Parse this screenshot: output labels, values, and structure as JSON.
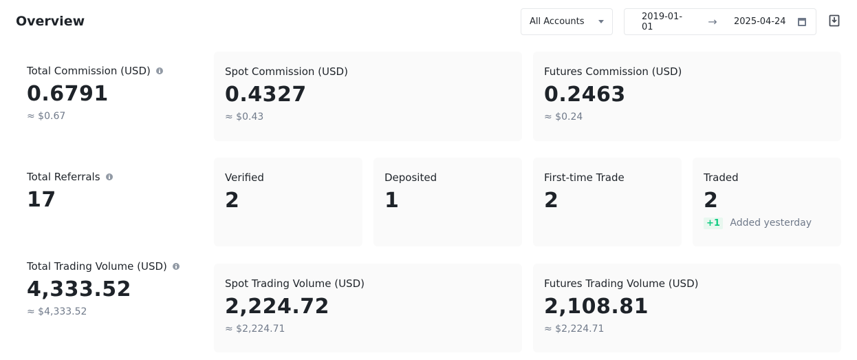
{
  "header": {
    "title": "Overview",
    "account_select": "All Accounts",
    "date_from": "2019-01-01",
    "date_to": "2025-04-24"
  },
  "commission": {
    "total": {
      "label": "Total Commission (USD)",
      "value": "0.6791",
      "approx": "≈ $0.67"
    },
    "spot": {
      "label": "Spot Commission (USD)",
      "value": "0.4327",
      "approx": "≈ $0.43"
    },
    "futures": {
      "label": "Futures Commission (USD)",
      "value": "0.2463",
      "approx": "≈ $0.24"
    }
  },
  "referrals": {
    "total": {
      "label": "Total Referrals",
      "value": "17"
    },
    "verified": {
      "label": "Verified",
      "value": "2"
    },
    "deposited": {
      "label": "Deposited",
      "value": "1"
    },
    "first_trade": {
      "label": "First-time Trade",
      "value": "2"
    },
    "traded": {
      "label": "Traded",
      "value": "2",
      "badge": "+1",
      "note": "Added yesterday"
    }
  },
  "volume": {
    "total": {
      "label": "Total Trading Volume (USD)",
      "value": "4,333.52",
      "approx": "≈ $4,333.52"
    },
    "spot": {
      "label": "Spot Trading Volume (USD)",
      "value": "2,224.72",
      "approx": "≈ $2,224.71"
    },
    "futures": {
      "label": "Futures Trading Volume (USD)",
      "value": "2,108.81",
      "approx": "≈ $2,224.71"
    }
  },
  "colors": {
    "accent_green": "#0ecb81",
    "card_bg": "#fafafa",
    "muted": "#707a8a"
  },
  "icons": {
    "info": "info-icon",
    "calendar": "calendar-icon",
    "export": "export-icon",
    "arrow": "arrow-right-icon"
  }
}
